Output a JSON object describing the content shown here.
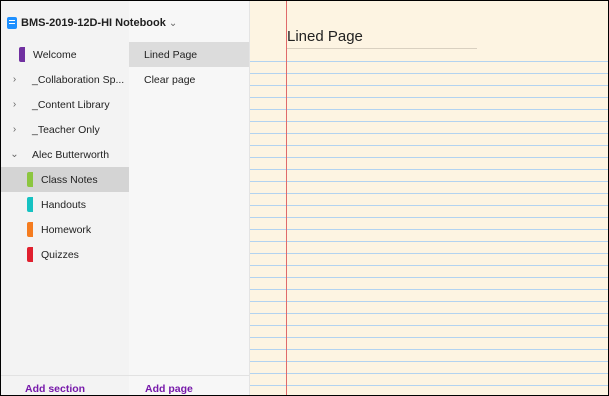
{
  "notebook": {
    "title": "BMS-2019-12D-HI Notebook",
    "chevron": "⌄",
    "icon": "notebook-icon",
    "color": "#1e90ff"
  },
  "sections": [
    {
      "label": "Welcome",
      "type": "section",
      "color": "#7030a0"
    },
    {
      "label": "_Collaboration Sp...",
      "type": "group"
    },
    {
      "label": "_Content Library",
      "type": "group"
    },
    {
      "label": "_Teacher Only",
      "type": "group"
    },
    {
      "label": "Alec Butterworth",
      "type": "group-expanded"
    },
    {
      "label": "Class Notes",
      "type": "section",
      "color": "#8cc63f",
      "selected": true
    },
    {
      "label": "Handouts",
      "type": "section",
      "color": "#16c2c2"
    },
    {
      "label": "Homework",
      "type": "section",
      "color": "#f57c1f"
    },
    {
      "label": "Quizzes",
      "type": "section",
      "color": "#e0202e"
    }
  ],
  "pages": [
    {
      "label": "Lined Page",
      "selected": true
    },
    {
      "label": "Clear page"
    }
  ],
  "footer": {
    "add_section": "Add section",
    "add_page": "Add page",
    "link_color": "#7719aa"
  },
  "canvas": {
    "title": "Lined Page",
    "background": "#fdf4e2",
    "rule_color": "#b3d3f0",
    "margin_color": "#e06a6a"
  }
}
